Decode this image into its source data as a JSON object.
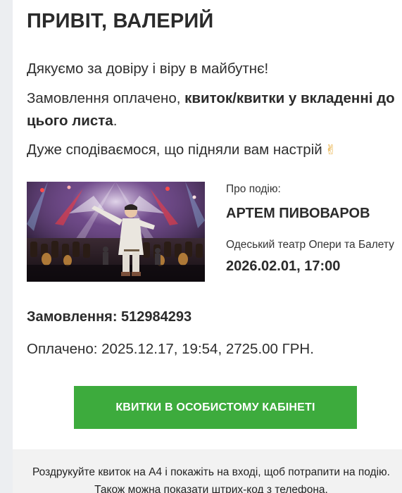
{
  "greeting": "ПРИВІТ, ВАЛЕРИЙ",
  "thanks": "Дякуємо за довіру і віру в майбутнє!",
  "payment_note": {
    "prefix": "Замовлення оплачено, ",
    "bold": "квиток/квитки у вкладенні до цього листа",
    "suffix": "."
  },
  "mood_line": "Дуже сподіваємося, що підняли вам настрій",
  "mood_emoji": "✌",
  "event": {
    "about_label": "Про подію:",
    "artist": "АРТЕМ ПИВОВАРОВ",
    "venue": "Одеський театр Опери та Балету",
    "datetime": "2026.02.01, 17:00"
  },
  "order_line": "Замовлення: 512984293",
  "paid_line": "Оплачено: 2025.12.17, 19:54, 2725.00 ГРН.",
  "cta_label": "КВИТКИ В ОСОБИСТОМУ КАБІНЕТІ",
  "footer_note": "Роздрукуйте квиток на А4 і покажіть на вході, щоб потрапити на подію. Також можна показати штрих-код з телефона.",
  "colors": {
    "button_green": "#3dab3d",
    "text_dark": "#2b2b2b",
    "footer_bg": "#f2f2f2"
  }
}
